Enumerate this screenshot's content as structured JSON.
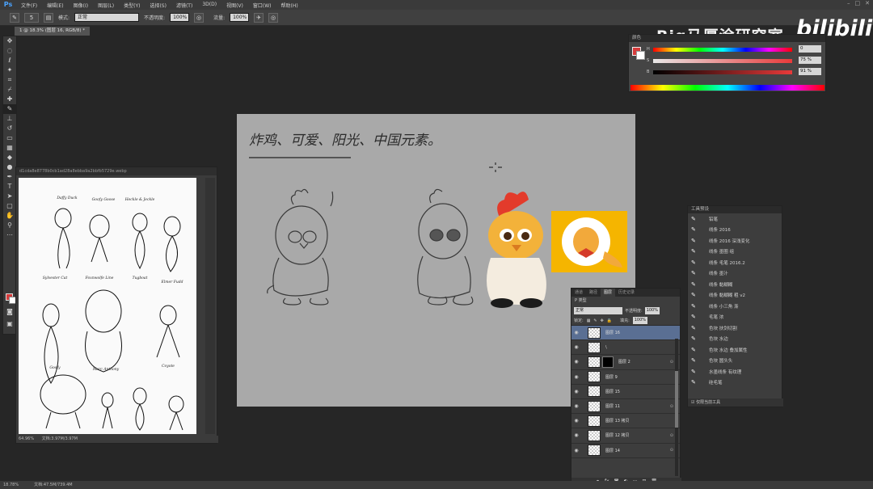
{
  "app": {
    "logo": "Ps"
  },
  "menu": [
    "文件(F)",
    "编辑(E)",
    "图像(I)",
    "图层(L)",
    "类型(Y)",
    "选择(S)",
    "滤镜(T)",
    "3D(D)",
    "视图(V)",
    "窗口(W)",
    "帮助(H)"
  ],
  "options": {
    "mode_label": "模式:",
    "mode_value": "正常",
    "opacity_label": "不透明度:",
    "opacity_value": "100%",
    "flow_label": "流量:",
    "flow_value": "100%",
    "brush_size": "5"
  },
  "document_tab": "1 @ 18.3% (图层 16, RGB/8) *",
  "watermark": {
    "text": "Big马厚涂研究室",
    "logo": "bilibili"
  },
  "color_panel": {
    "title": "颜色",
    "sliders": [
      {
        "label": "H",
        "value": "0",
        "unit": ""
      },
      {
        "label": "S",
        "value": "75",
        "unit": "%"
      },
      {
        "label": "B",
        "value": "91",
        "unit": "%"
      }
    ],
    "foreground": "#d63b3b"
  },
  "canvas": {
    "handwriting": "炸鸡、可爱、阳光、中国元素。"
  },
  "reference_window": {
    "title": "d1cda8e8778b0cb1ad28a8ebba9a2bbfb5729e.webp",
    "status_zoom": "64.96%",
    "status_doc": "文档:3.97M/3.97M",
    "labels": [
      "Daffy Duck",
      "Goofy Goose",
      "Heckle & Jeckle",
      "Sylvester Cat",
      "Foxnwolfe Line",
      "Tugboat",
      "Elmer Fudd",
      "Goofy",
      "Marc Anthony",
      "Coyote"
    ]
  },
  "brush_panel": {
    "title": "工具预设",
    "items": [
      "铅笔",
      "线条 2016",
      "线条 2016 深浅变化",
      "线条 墨圈 组",
      "线条 毛笔 2016.2",
      "线条 墨汁",
      "线条 黏糊糊",
      "线条 黏糊糊 粗 v2",
      "线条 小三角 渐",
      "毛笔 浓",
      "色块 扶剑切割",
      "色块 水边",
      "色块 水边 叠加属性",
      "色块 圆头头",
      "水墨线条 有纹理",
      "硅毛笔"
    ],
    "footer": "仅限当前工具"
  },
  "layers_panel": {
    "tabs": [
      "通道",
      "路径",
      "图层",
      "历史记录"
    ],
    "filter": "P 类型",
    "blend_mode": "正常",
    "opacity_label": "不透明度:",
    "opacity": "100%",
    "lock_label": "锁定:",
    "fill_label": "填充:",
    "fill": "100%",
    "layers": [
      {
        "name": "图层 16",
        "selected": true,
        "mask": false,
        "fx": false
      },
      {
        "name": "\\",
        "selected": false,
        "mask": false,
        "fx": false
      },
      {
        "name": "图层 2",
        "selected": false,
        "mask": true,
        "fx": true
      },
      {
        "name": "图层 9",
        "selected": false,
        "mask": false,
        "fx": false
      },
      {
        "name": "图层 15",
        "selected": false,
        "mask": false,
        "fx": false
      },
      {
        "name": "图层 11",
        "selected": false,
        "mask": false,
        "fx": true
      },
      {
        "name": "图层 13 拷贝",
        "selected": false,
        "mask": false,
        "fx": false
      },
      {
        "name": "图层 12 拷贝",
        "selected": false,
        "mask": false,
        "fx": true
      },
      {
        "name": "图层 14",
        "selected": false,
        "mask": false,
        "fx": true
      }
    ]
  },
  "statusbar": {
    "zoom": "18.78%",
    "doc": "文档:47.5M/739.4M"
  }
}
